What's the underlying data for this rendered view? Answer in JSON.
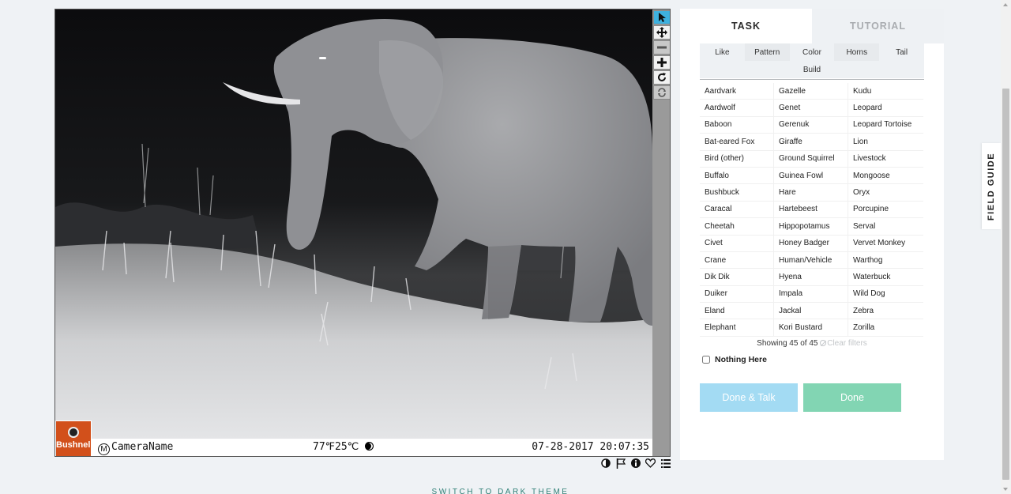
{
  "viewer": {
    "camera_brand": "Bushnell",
    "camera_name": "CameraName",
    "camera_mark": "M",
    "temperature": "77℉25℃",
    "timestamp": "07-28-2017 20:07:35",
    "tools": [
      {
        "name": "pointer-icon",
        "state": "active"
      },
      {
        "name": "move-icon",
        "state": "normal"
      },
      {
        "name": "zoom-out-icon",
        "state": "disabled"
      },
      {
        "name": "zoom-in-icon",
        "state": "normal"
      },
      {
        "name": "rotate-icon",
        "state": "normal"
      },
      {
        "name": "reset-icon",
        "state": "disabled"
      }
    ],
    "actions": [
      "invert-icon",
      "flag-icon",
      "info-icon",
      "favorite-icon",
      "collections-icon"
    ]
  },
  "panel": {
    "tabs": [
      {
        "label": "TASK",
        "active": true
      },
      {
        "label": "TUTORIAL",
        "active": false
      }
    ],
    "filters_row1": [
      "Like",
      "Pattern",
      "Color",
      "Horns",
      "Tail"
    ],
    "filters_row2": [
      "Build"
    ],
    "species": [
      "Aardvark",
      "Gazelle",
      "Kudu",
      "Aardwolf",
      "Genet",
      "Leopard",
      "Baboon",
      "Gerenuk",
      "Leopard Tortoise",
      "Bat-eared Fox",
      "Giraffe",
      "Lion",
      "Bird (other)",
      "Ground Squirrel",
      "Livestock",
      "Buffalo",
      "Guinea Fowl",
      "Mongoose",
      "Bushbuck",
      "Hare",
      "Oryx",
      "Caracal",
      "Hartebeest",
      "Porcupine",
      "Cheetah",
      "Hippopotamus",
      "Serval",
      "Civet",
      "Honey Badger",
      "Vervet Monkey",
      "Crane",
      "Human/Vehicle",
      "Warthog",
      "Dik Dik",
      "Hyena",
      "Waterbuck",
      "Duiker",
      "Impala",
      "Wild Dog",
      "Eland",
      "Jackal",
      "Zebra",
      "Elephant",
      "Kori Bustard",
      "Zorilla"
    ],
    "showing": "Showing 45 of 45",
    "clear_filters": "Clear filters",
    "nothing_here": "Nothing Here",
    "done_talk_label": "Done & Talk",
    "done_label": "Done"
  },
  "field_guide": "FIELD GUIDE",
  "theme_switch": "SWITCH TO DARK THEME",
  "colors": {
    "active_tool": "#3eb1df",
    "done_talk": "#a3dbf3",
    "done": "#82d5b3",
    "theme_link": "#2f7f76",
    "brand_orange": "#d2501b"
  }
}
